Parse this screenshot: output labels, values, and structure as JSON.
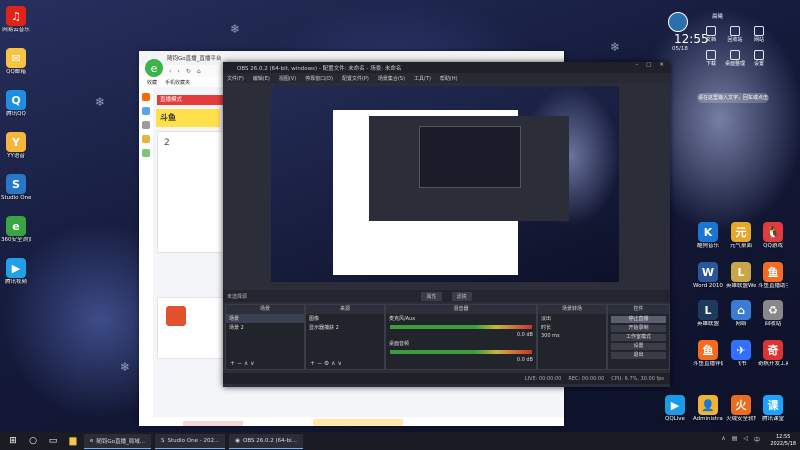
{
  "desktop_left_icons": [
    {
      "label": "网易云音乐",
      "glyph": "♫",
      "color": "#e2231a"
    },
    {
      "label": "QQ邮箱",
      "glyph": "✉",
      "color": "#f6c443"
    },
    {
      "label": "腾讯QQ",
      "glyph": "Q",
      "color": "#1f8fe3"
    },
    {
      "label": "YY语音",
      "glyph": "Y",
      "color": "#f4b73a"
    },
    {
      "label": "Studio One3",
      "glyph": "S",
      "color": "#2a76c8"
    },
    {
      "label": "360安全浏览器",
      "glyph": "e",
      "color": "#37a541"
    },
    {
      "label": "腾讯视频",
      "glyph": "▶",
      "color": "#21a0ea"
    }
  ],
  "widget": {
    "clock": "12:55",
    "date": "05/18",
    "weather": "晨曦",
    "search_placeholder": "请在这里输入文字，回车或点击",
    "buttons": [
      "文档",
      "回收站",
      "网站",
      "下载",
      "桌面整理",
      "设置"
    ]
  },
  "desktop_right_icons": [
    {
      "label": "酷狗音乐",
      "glyph": "K",
      "color": "#1976d2"
    },
    {
      "label": "元气桌面",
      "glyph": "元",
      "color": "#e5a82a"
    },
    {
      "label": "QQ游戏",
      "glyph": "🐧",
      "color": "#e33b3b"
    },
    {
      "label": "Word 2010",
      "glyph": "W",
      "color": "#2b579a"
    },
    {
      "label": "英雄联盟WeGame",
      "glyph": "L",
      "color": "#c9a646"
    },
    {
      "label": "斗鱼直播助手",
      "glyph": "鱼",
      "color": "#f56b1f"
    },
    {
      "label": "英雄联盟",
      "glyph": "L",
      "color": "#1f3a5f"
    },
    {
      "label": "网络",
      "glyph": "⌂",
      "color": "#3a7bd5"
    },
    {
      "label": "回收站",
      "glyph": "♻",
      "color": "#888888"
    },
    {
      "label": "斗鱼直播伴侣",
      "glyph": "鱼",
      "color": "#f56b1f"
    },
    {
      "label": "飞书",
      "glyph": "✈",
      "color": "#3370ff"
    },
    {
      "label": "奇帆开发工具",
      "glyph": "奇",
      "color": "#d33"
    },
    {
      "label": "QQLive",
      "glyph": "▶",
      "color": "#1a9be6"
    },
    {
      "label": "Administrator",
      "glyph": "👤",
      "color": "#f2b233"
    },
    {
      "label": "火绒安全软件",
      "glyph": "火",
      "color": "#ea6c1d"
    },
    {
      "label": "腾讯课堂",
      "glyph": "课",
      "color": "#1aa3ff"
    }
  ],
  "browser": {
    "title": "随钧Go直播_直播平台",
    "addr_hint": "",
    "bookmarks": [
      "收藏",
      "手机收藏夹"
    ],
    "header": "直播模式",
    "brand": "斗鱼",
    "count": "2",
    "card_text": "直播"
  },
  "obs": {
    "title": "OBS 26.0.2 (64-bit, windows) - 配置文件: 未命名 - 场景: 未命名",
    "menu": [
      "文件(F)",
      "编辑(E)",
      "视图(V)",
      "停靠窗口(D)",
      "配置文件(P)",
      "场景集合(S)",
      "工具(T)",
      "帮助(H)"
    ],
    "ctrl_buttons": [
      "属性",
      "滤镜"
    ],
    "ctrl_label": "未选择源",
    "docks": {
      "scenes": {
        "title": "场景",
        "items": [
          "场景",
          "场景 2"
        ]
      },
      "sources": {
        "title": "来源",
        "items": [
          "图像",
          "显示器捕获 2"
        ]
      },
      "mixer": {
        "title": "混音器",
        "tracks": [
          {
            "name": "麦克风/Aux",
            "db": "0.0 dB"
          },
          {
            "name": "桌面音频",
            "db": "0.0 dB"
          }
        ]
      },
      "transitions": {
        "title": "场景转场",
        "type": "淡出",
        "duration_label": "时长",
        "duration": "300 ms"
      },
      "controls": {
        "title": "控件",
        "buttons": [
          "停止直播",
          "开始录制",
          "工作室模式",
          "设置",
          "退出"
        ]
      }
    },
    "status": {
      "live": "LIVE: 00:00:00",
      "rec": "REC: 00:00:00",
      "cpu": "CPU: 6.7%, 30.00 fps"
    }
  },
  "taskbar": {
    "apps": [
      {
        "label": "随钧Go直播_局域...",
        "glyph": "e"
      },
      {
        "label": "Studio One - 202...",
        "glyph": "S"
      },
      {
        "label": "OBS 26.0.2 (64-bi...",
        "glyph": "◉"
      }
    ],
    "time": "12:55",
    "date": "2022/5/18"
  }
}
